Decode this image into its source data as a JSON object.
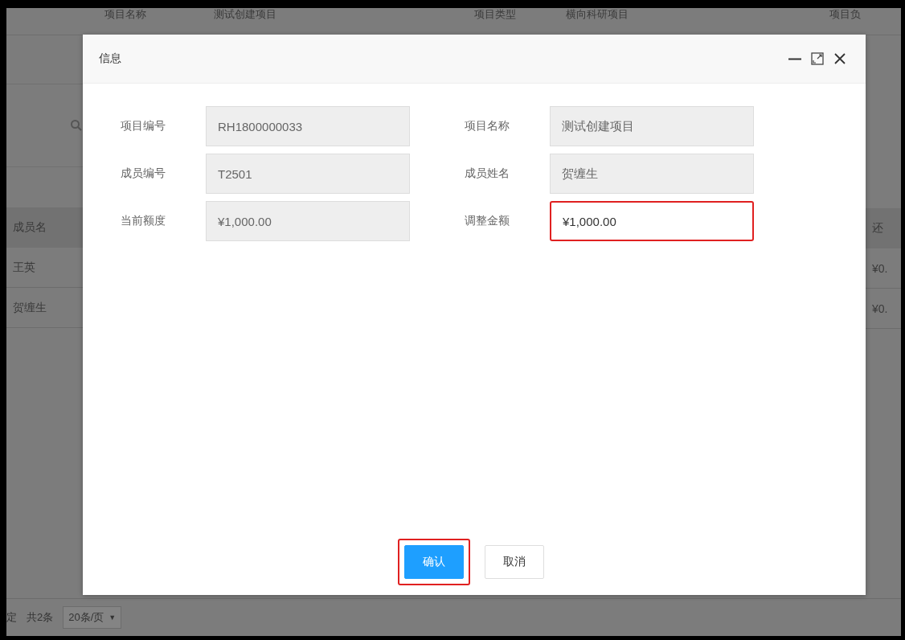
{
  "background_page": {
    "info_row": [
      "项目名称",
      "测试创建项目",
      "项目类型",
      "横向科研项目",
      "项目负"
    ],
    "table": {
      "left_column": {
        "header": "成员名",
        "rows": [
          "王英",
          "贺缠生"
        ]
      },
      "right_column": {
        "header": "还",
        "rows": [
          "¥0.",
          "¥0."
        ]
      }
    },
    "pager": {
      "left_text": "定",
      "total": "共2条",
      "page_size": "20条/页",
      "caret": "▼"
    }
  },
  "dialog": {
    "title": "信息",
    "fields": [
      {
        "label": "项目编号",
        "value": "RH1800000033",
        "disabled": true,
        "highlighted": false
      },
      {
        "label": "项目名称",
        "value": "测试创建项目",
        "disabled": true,
        "highlighted": false
      },
      {
        "label": "成员编号",
        "value": "T2501",
        "disabled": true,
        "highlighted": false
      },
      {
        "label": "成员姓名",
        "value": "贺缠生",
        "disabled": true,
        "highlighted": false
      },
      {
        "label": "当前额度",
        "value": "¥1,000.00",
        "disabled": true,
        "highlighted": false
      },
      {
        "label": "调整金额",
        "value": "¥1,000.00",
        "disabled": false,
        "highlighted": true
      }
    ],
    "buttons": [
      {
        "label": "确认",
        "kind": "primary",
        "highlighted": true
      },
      {
        "label": "取消",
        "kind": "default",
        "highlighted": false
      }
    ]
  }
}
